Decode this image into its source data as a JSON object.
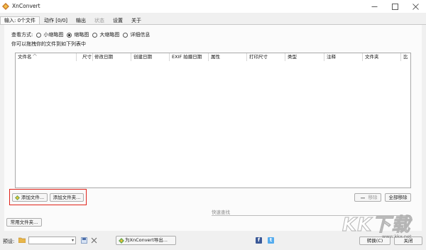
{
  "window": {
    "title": "XnConvert"
  },
  "tabs": [
    {
      "label": "输入: 0个文件",
      "state": "active"
    },
    {
      "label": "动作 [0/0]",
      "state": "normal"
    },
    {
      "label": "输出",
      "state": "normal"
    },
    {
      "label": "状态",
      "state": "disabled"
    },
    {
      "label": "设置",
      "state": "normal"
    },
    {
      "label": "关于",
      "state": "normal"
    }
  ],
  "view_mode": {
    "label": "查看方式:",
    "options": [
      "小缩略图",
      "缩略图",
      "大缩略图",
      "详细信息"
    ],
    "selected": "缩略图"
  },
  "drop_hint": "你可以拖拽你的文件到如下列表中",
  "file_list": {
    "columns": [
      "文件名",
      "尺寸",
      "修改日期",
      "创建日期",
      "EXIF 拍摄日期",
      "属性",
      "打印尺寸",
      "类型",
      "注释",
      "文件夹",
      "比"
    ]
  },
  "buttons": {
    "add_file": "添加文件...",
    "add_folder": "添加文件夹...",
    "remove": "移除",
    "remove_all": "全部移除",
    "common_folders": "常用文件夹...",
    "convert": "转换(C)",
    "close": "关闭",
    "export": "为XnConvert导出..."
  },
  "quick_search": {
    "placeholder": "快速查找"
  },
  "preset": {
    "label": "预设:",
    "value": ""
  },
  "watermark": {
    "text": "KK下载",
    "url": "www.kkx.net"
  },
  "colors": {
    "highlight": "#e0241b",
    "tab_active": "#fbfbfb",
    "window_bg": "#f0f0f0"
  }
}
